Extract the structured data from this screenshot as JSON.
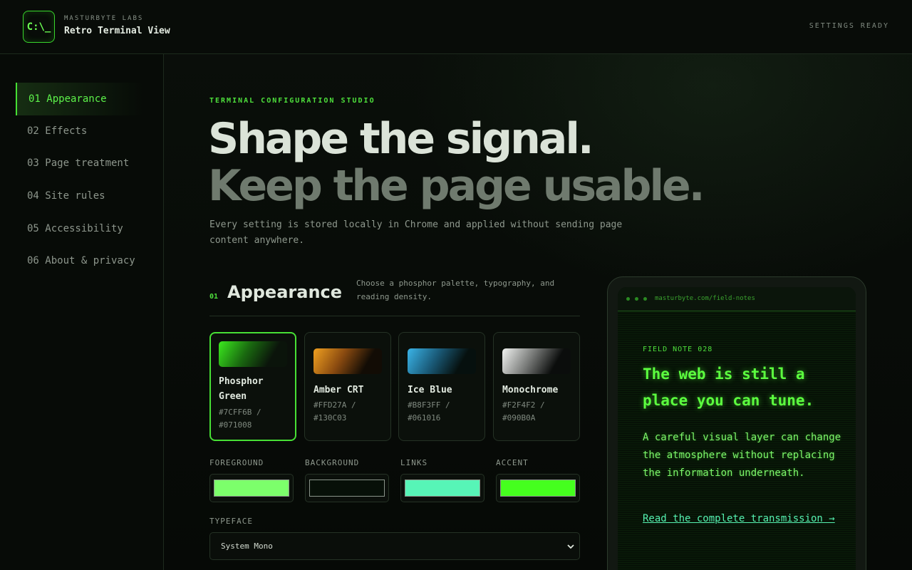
{
  "header": {
    "logo_text": "C:\\_",
    "brand_small": "MASTURBYTE LABS",
    "brand_title": "Retro Terminal View",
    "status": "SETTINGS READY"
  },
  "sidebar": {
    "items": [
      {
        "label": "01 Appearance",
        "active": true
      },
      {
        "label": "02 Effects"
      },
      {
        "label": "03 Page treatment"
      },
      {
        "label": "04 Site rules"
      },
      {
        "label": "05 Accessibility"
      },
      {
        "label": "06 About & privacy"
      }
    ]
  },
  "main": {
    "eyebrow": "TERMINAL CONFIGURATION STUDIO",
    "hero_line1": "Shape the signal.",
    "hero_line2": "Keep the page usable.",
    "hero_sub": "Every setting is stored locally in Chrome and applied without sending page content anywhere.",
    "section": {
      "number": "01",
      "title": "Appearance",
      "description": "Choose a phosphor palette, typography, and reading density."
    },
    "palettes": [
      {
        "name": "Phosphor Green",
        "hex": "#7CFF6B / #071008",
        "color": "#3bea1e",
        "selected": true
      },
      {
        "name": "Amber CRT",
        "hex": "#FFD27A / #130C03",
        "color": "#f0a020"
      },
      {
        "name": "Ice Blue",
        "hex": "#B8F3FF / #061016",
        "color": "#3ab4e8"
      },
      {
        "name": "Monochrome",
        "hex": "#F2F4F2 / #090B0A",
        "color": "#f2f4f2"
      }
    ],
    "colors": [
      {
        "label": "FOREGROUND",
        "value": "#7CFF6B"
      },
      {
        "label": "BACKGROUND",
        "value": "#071008"
      },
      {
        "label": "LINKS",
        "value": "#57F5B7"
      },
      {
        "label": "ACCENT",
        "value": "#45FF1E"
      }
    ],
    "typeface": {
      "label": "TYPEFACE",
      "value": "System Mono"
    }
  },
  "preview": {
    "url": "masturbyte.com/field-notes",
    "eyebrow": "FIELD NOTE 028",
    "title": "The web is still a place you can tune.",
    "body": "A careful visual layer can change the atmosphere without replacing the information underneath.",
    "link": "Read the complete transmission →"
  }
}
